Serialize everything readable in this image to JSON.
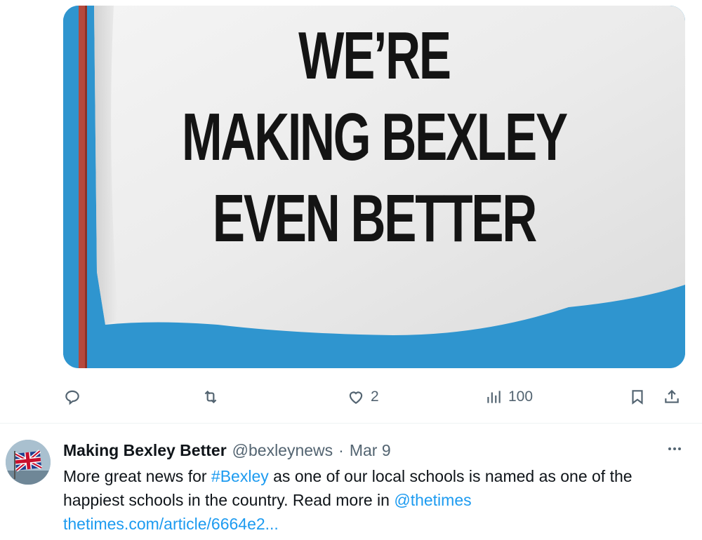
{
  "media": {
    "banner_lines": [
      "WE’RE",
      "MAKING BEXLEY",
      "EVEN BETTER"
    ]
  },
  "actions": {
    "reply": {
      "icon": "reply-icon",
      "count": ""
    },
    "retweet": {
      "icon": "retweet-icon",
      "count": ""
    },
    "like": {
      "icon": "heart-icon",
      "count": "2"
    },
    "views": {
      "icon": "views-icon",
      "count": "100"
    },
    "bookmark": {
      "icon": "bookmark-icon"
    },
    "share": {
      "icon": "share-icon"
    }
  },
  "tweet": {
    "display_name": "Making Bexley Better",
    "handle": "@bexleynews",
    "separator": "·",
    "date": "Mar 9",
    "text_part1": "More great news for ",
    "hashtag": "#Bexley",
    "text_part2": " as one of our local schools is named as one of the happiest schools in the country. Read more in ",
    "mention": "@thetimes",
    "url": "thetimes.com/article/6664e2..."
  },
  "colors": {
    "accent": "#1d9bf0",
    "muted": "#536471",
    "banner_blue": "#2f95cf",
    "pole_red": "#b5493c"
  }
}
